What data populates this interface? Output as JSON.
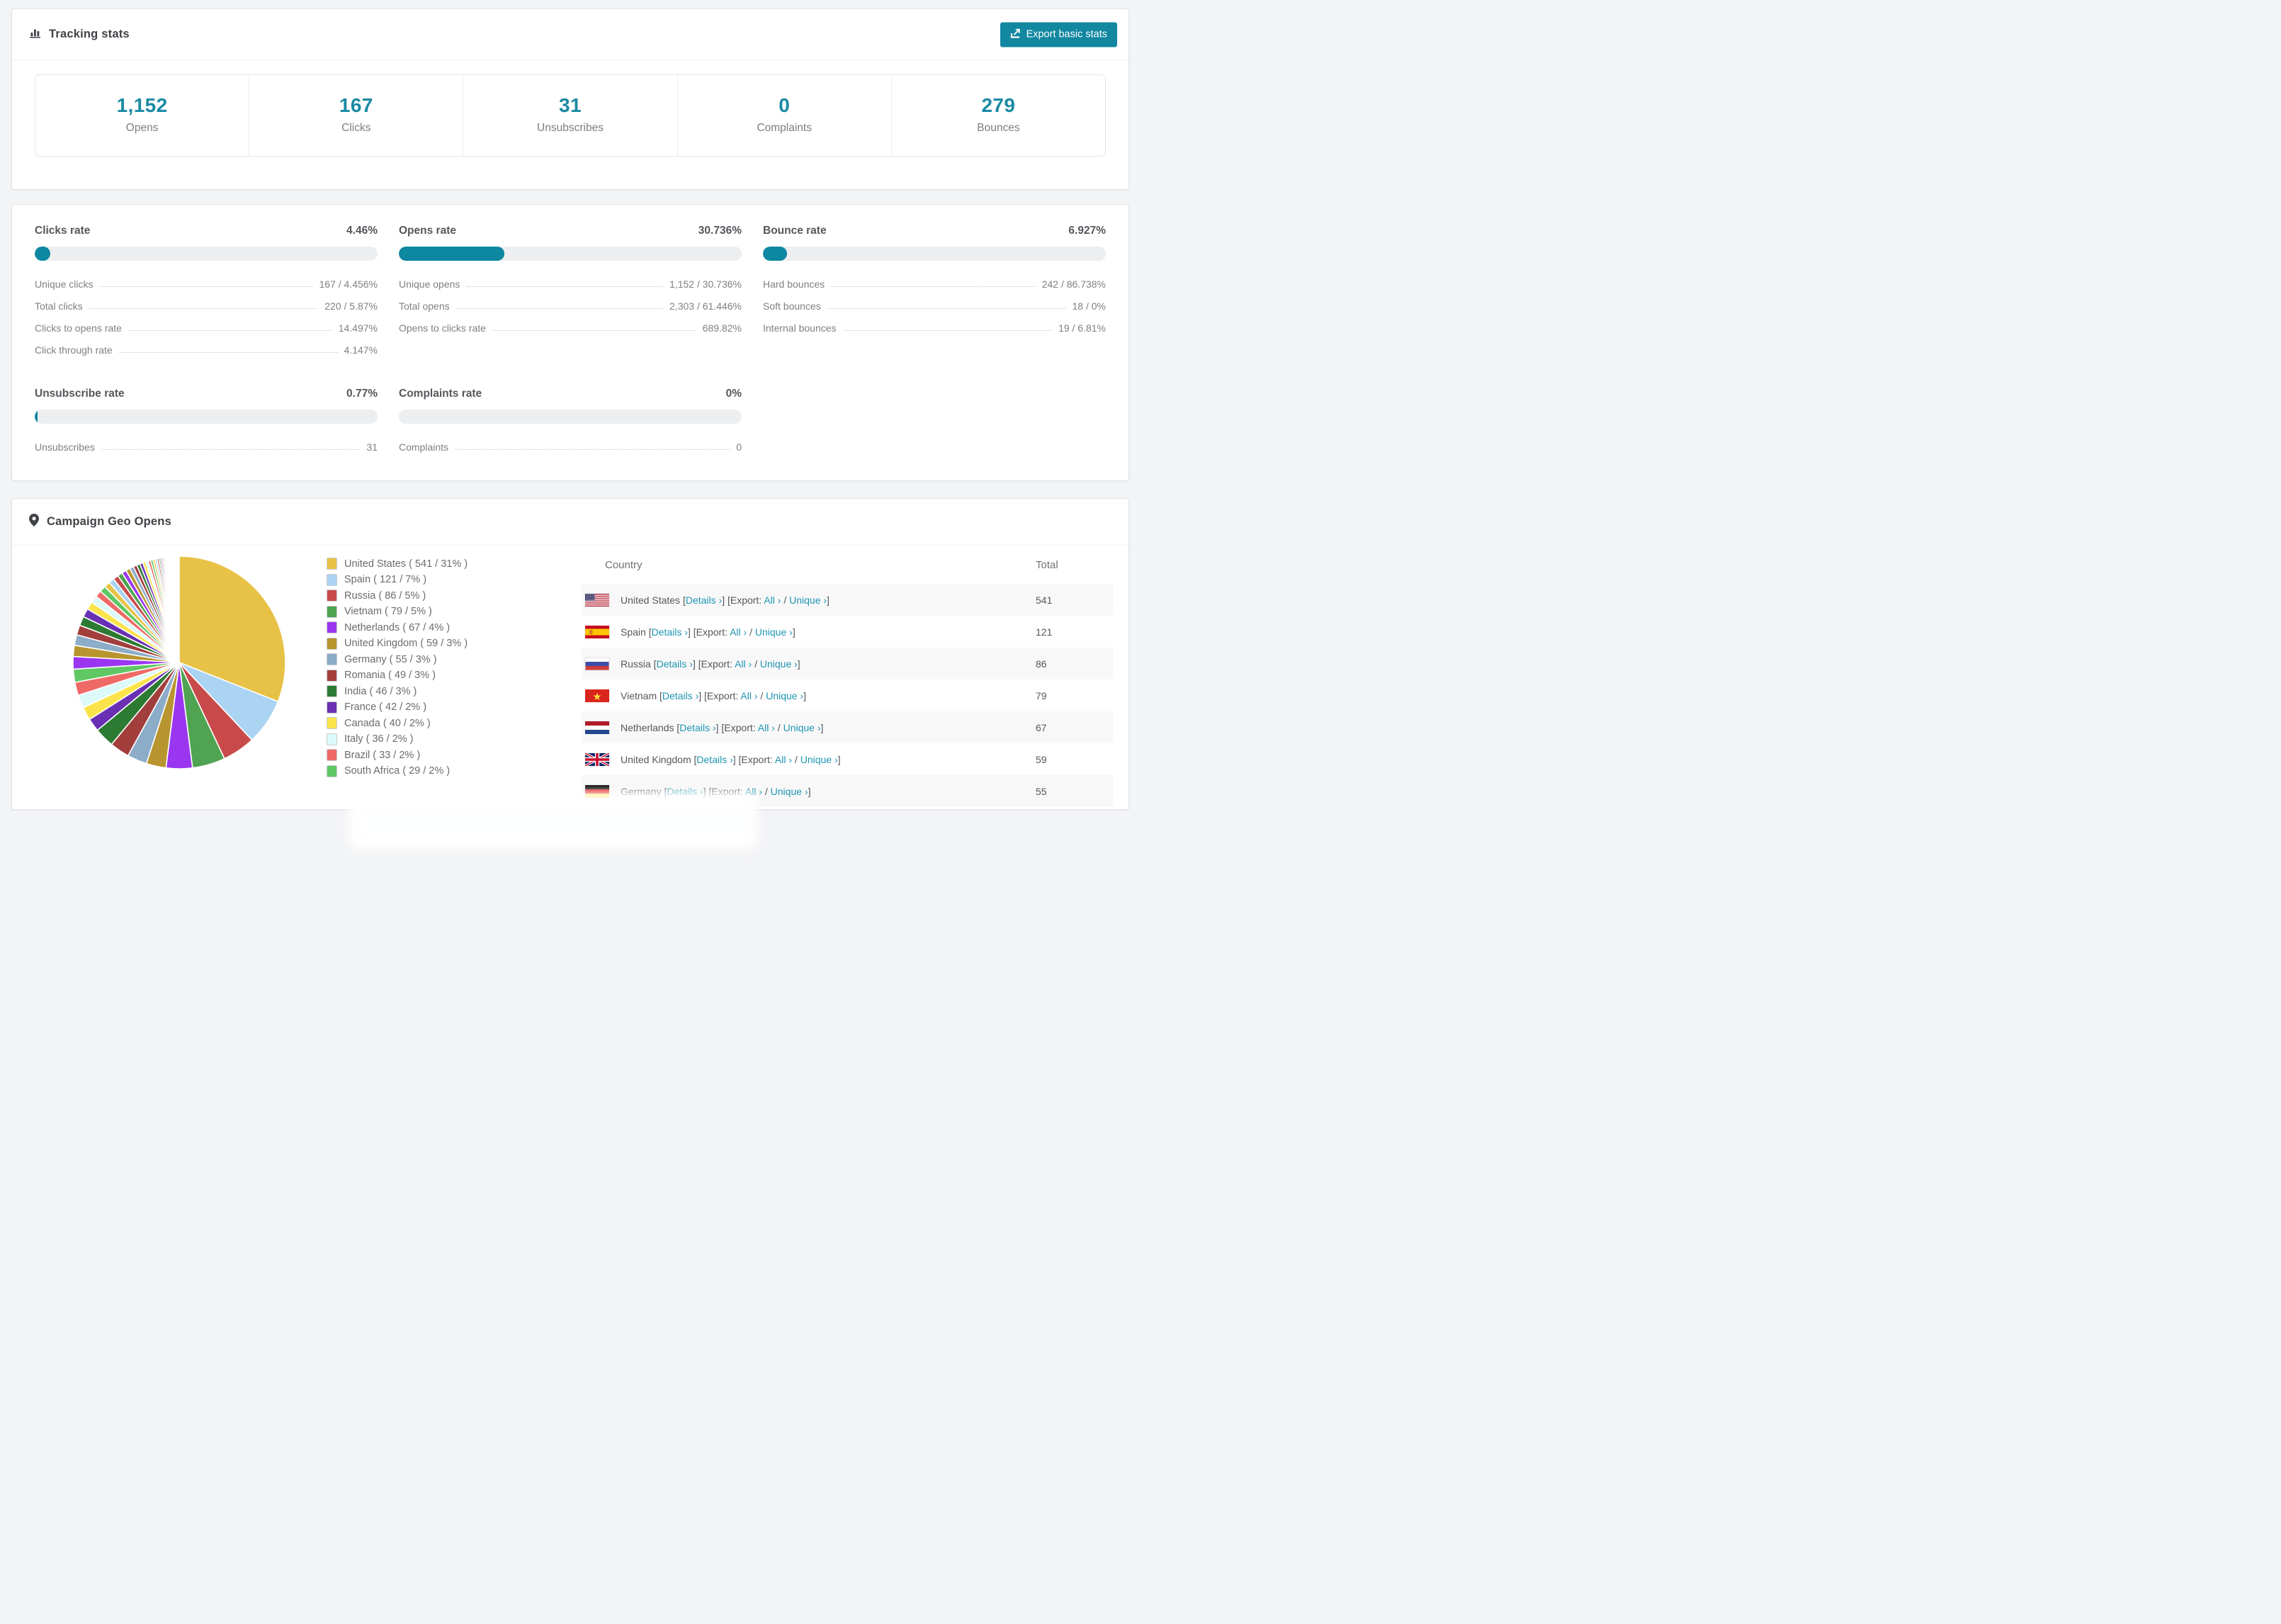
{
  "colors": {
    "accent": "#1187a0",
    "number_teal": "#1b8aa4",
    "bar_fill": "#0e87a0",
    "link": "#1f95b1"
  },
  "header": {
    "title": "Tracking stats",
    "export_button": "Export basic stats"
  },
  "summary_stats": [
    {
      "value": "1,152",
      "label": "Opens"
    },
    {
      "value": "167",
      "label": "Clicks"
    },
    {
      "value": "31",
      "label": "Unsubscribes"
    },
    {
      "value": "0",
      "label": "Complaints"
    },
    {
      "value": "279",
      "label": "Bounces"
    }
  ],
  "rate_panels": [
    {
      "title": "Clicks rate",
      "percent": "4.46%",
      "fill_pct": 4.46,
      "rows": [
        {
          "label": "Unique clicks",
          "value": "167 / 4.456%"
        },
        {
          "label": "Total clicks",
          "value": "220 / 5.87%"
        },
        {
          "label": "Clicks to opens rate",
          "value": "14.497%"
        },
        {
          "label": "Click through rate",
          "value": "4.147%"
        }
      ]
    },
    {
      "title": "Opens rate",
      "percent": "30.736%",
      "fill_pct": 30.736,
      "rows": [
        {
          "label": "Unique opens",
          "value": "1,152 / 30.736%"
        },
        {
          "label": "Total opens",
          "value": "2,303 / 61.446%"
        },
        {
          "label": "Opens to clicks rate",
          "value": "689.82%"
        }
      ]
    },
    {
      "title": "Bounce rate",
      "percent": "6.927%",
      "fill_pct": 6.927,
      "rows": [
        {
          "label": "Hard bounces",
          "value": "242 / 86.738%"
        },
        {
          "label": "Soft bounces",
          "value": "18 / 0%"
        },
        {
          "label": "Internal bounces",
          "value": "19 / 6.81%"
        }
      ]
    },
    {
      "title": "Unsubscribe rate",
      "percent": "0.77%",
      "fill_pct": 0.77,
      "rows": [
        {
          "label": "Unsubscribes",
          "value": "31"
        }
      ]
    },
    {
      "title": "Complaints rate",
      "percent": "0%",
      "fill_pct": 0,
      "rows": [
        {
          "label": "Complaints",
          "value": "0"
        }
      ]
    }
  ],
  "geo": {
    "title": "Campaign Geo Opens",
    "table": {
      "columns": [
        "Country",
        "Total"
      ],
      "chevron": "›",
      "link_labels": {
        "details": "Details",
        "export": "Export:",
        "all": "All",
        "unique": "Unique"
      },
      "rows": [
        {
          "country": "United States",
          "flag": "us",
          "total": "541"
        },
        {
          "country": "Spain",
          "flag": "es",
          "total": "121"
        },
        {
          "country": "Russia",
          "flag": "ru",
          "total": "86"
        },
        {
          "country": "Vietnam",
          "flag": "vn",
          "total": "79"
        },
        {
          "country": "Netherlands",
          "flag": "nl",
          "total": "67"
        },
        {
          "country": "United Kingdom",
          "flag": "gb",
          "total": "59"
        },
        {
          "country": "Germany",
          "flag": "de",
          "total": "55"
        }
      ]
    },
    "chart_data": {
      "type": "pie",
      "title": "Campaign Geo Opens",
      "start_angle_deg": 0,
      "legend_position": "right",
      "slices": [
        {
          "label": "United States",
          "value": 541,
          "pct": 31,
          "color": "#e8c246"
        },
        {
          "label": "Spain",
          "value": 121,
          "pct": 7,
          "color": "#abd3f2"
        },
        {
          "label": "Russia",
          "value": 86,
          "pct": 5,
          "color": "#c94a4a"
        },
        {
          "label": "Vietnam",
          "value": 79,
          "pct": 5,
          "color": "#4fa351"
        },
        {
          "label": "Netherlands",
          "value": 67,
          "pct": 4,
          "color": "#9a36f0"
        },
        {
          "label": "United Kingdom",
          "value": 59,
          "pct": 3,
          "color": "#b9952f"
        },
        {
          "label": "Germany",
          "value": 55,
          "pct": 3,
          "color": "#8cacc8"
        },
        {
          "label": "Romania",
          "value": 49,
          "pct": 3,
          "color": "#a23e3c"
        },
        {
          "label": "India",
          "value": 46,
          "pct": 3,
          "color": "#2d7a33"
        },
        {
          "label": "France",
          "value": 42,
          "pct": 2,
          "color": "#6930b3"
        },
        {
          "label": "Canada",
          "value": 40,
          "pct": 2,
          "color": "#fbe44b"
        },
        {
          "label": "Italy",
          "value": 36,
          "pct": 2,
          "color": "#dcfafa"
        },
        {
          "label": "Brazil",
          "value": 33,
          "pct": 2,
          "color": "#ef6a66"
        },
        {
          "label": "South Africa",
          "value": 29,
          "pct": 2,
          "color": "#5fc763"
        }
      ],
      "other_slices_pct": [
        1.9,
        1.7,
        1.6,
        1.5,
        1.4,
        1.3,
        1.2,
        1.1,
        1.0,
        0.95,
        0.9,
        0.85,
        0.8,
        0.75,
        0.7,
        0.65,
        0.6,
        0.55,
        0.5,
        0.47,
        0.44,
        0.41,
        0.38,
        0.35,
        0.32,
        0.3,
        0.28,
        0.26,
        0.24,
        0.22,
        0.2,
        0.18,
        0.16,
        0.14,
        0.13,
        0.12,
        0.11,
        0.1,
        0.09,
        0.08,
        0.07,
        0.06,
        0.05,
        0.05,
        0.04,
        0.04,
        0.03,
        0.03
      ]
    }
  }
}
